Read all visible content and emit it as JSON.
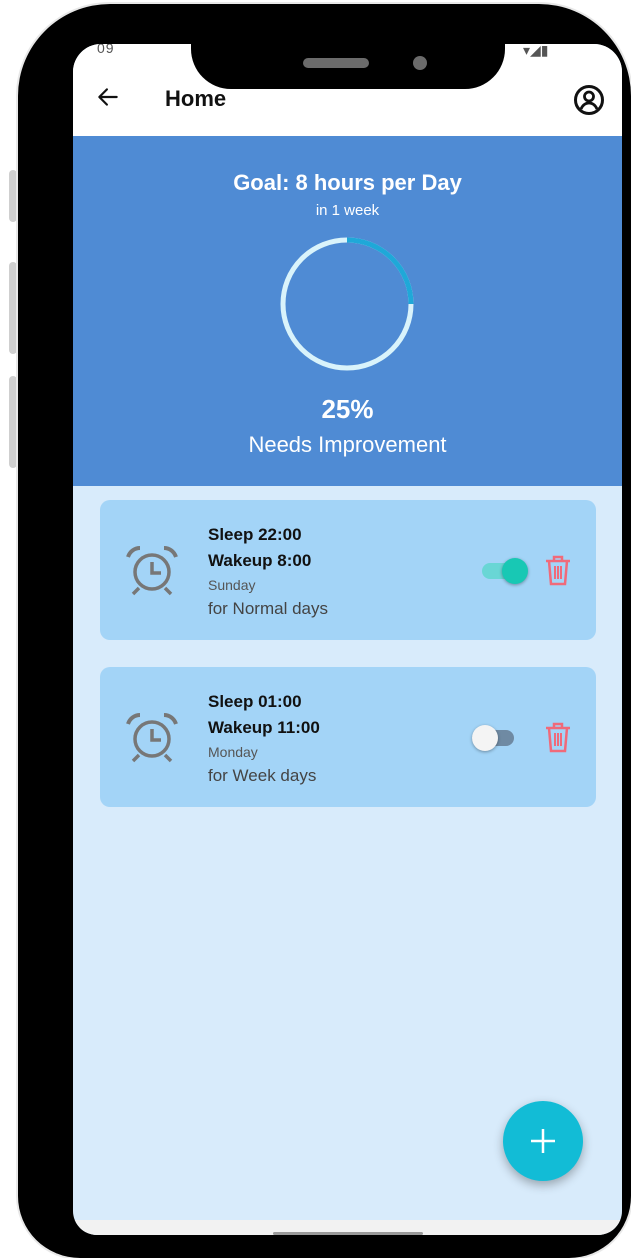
{
  "status_bar": {
    "left_text": "09",
    "right_text": "▾◢▮"
  },
  "appbar": {
    "title": "Home",
    "back_icon": "arrow-left-icon",
    "account_icon": "account-circle-icon"
  },
  "goal": {
    "title": "Goal: 8 hours per Day",
    "period": "in 1 week",
    "progress_fraction": 0.25,
    "percent_text": "25%",
    "status": "Needs Improvement",
    "ring_color": "#1fa8d8",
    "ring_track_color": "#d9f3fb"
  },
  "alarms": [
    {
      "sleep": "Sleep 22:00",
      "wakeup": "Wakeup 8:00",
      "day": "Sunday",
      "type": "for Normal days",
      "enabled": true,
      "icon": "alarm-clock-icon",
      "delete_icon": "trash-icon"
    },
    {
      "sleep": "Sleep 01:00",
      "wakeup": "Wakeup 11:00",
      "day": "Monday",
      "type": "for Week days",
      "enabled": false,
      "icon": "alarm-clock-icon",
      "delete_icon": "trash-icon"
    }
  ],
  "fab": {
    "icon": "plus-icon",
    "color": "#12bcd6"
  },
  "colors": {
    "header": "#4f8bd4",
    "background": "#d8ebfb",
    "card": "#a3d4f7",
    "toggle_on": "#18c8b4",
    "trash": "#f06a7a"
  }
}
